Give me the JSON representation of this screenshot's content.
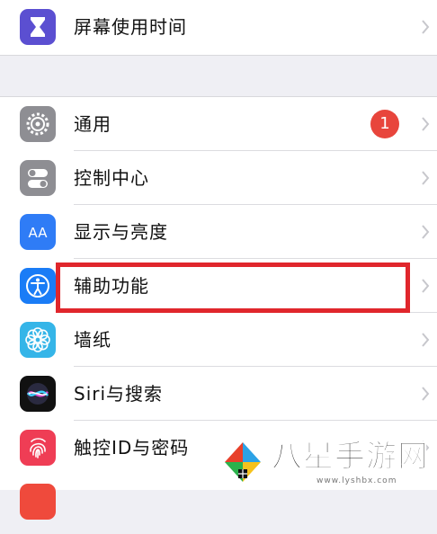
{
  "settings": {
    "top_group": [
      {
        "label": "屏幕使用时间",
        "icon": "hourglass-icon",
        "color": "#5b4fd1"
      }
    ],
    "main_group": [
      {
        "label": "通用",
        "icon": "gear-icon",
        "color": "#8e8e93",
        "badge": "1"
      },
      {
        "label": "控制中心",
        "icon": "toggles-icon",
        "color": "#8e8e93"
      },
      {
        "label": "显示与亮度",
        "icon": "text-size-icon",
        "color": "#2f7cf6"
      },
      {
        "label": "辅助功能",
        "icon": "accessibility-icon",
        "color": "#1a7cf6"
      },
      {
        "label": "墙纸",
        "icon": "flower-icon",
        "color": "#35b5e8"
      },
      {
        "label": "Siri与搜索",
        "icon": "siri-icon",
        "color": "#111111"
      },
      {
        "label": "触控ID与密码",
        "icon": "fingerprint-icon",
        "color": "#ef3d55"
      }
    ]
  },
  "annotation": {
    "highlight_color": "#e0262c",
    "target": "辅助功能"
  },
  "watermark": {
    "text": "八星手游网",
    "url": "www.lyshbx.com"
  }
}
